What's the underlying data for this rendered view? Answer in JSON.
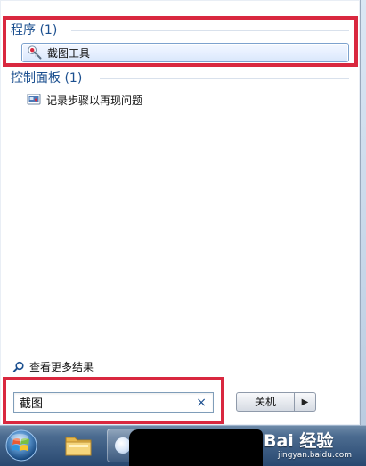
{
  "start_menu": {
    "sections": [
      {
        "title": "程序 (1)",
        "items": [
          {
            "label": "截图工具",
            "icon": "snipping-tool-icon",
            "selected": true
          }
        ]
      },
      {
        "title": "控制面板 (1)",
        "items": [
          {
            "label": "记录步骤以再现问题",
            "icon": "steps-recorder-icon",
            "selected": false
          }
        ]
      }
    ],
    "see_more_results": "查看更多结果",
    "search": {
      "value": "截图",
      "clear_icon": "clear-search-icon",
      "clear_glyph": "×"
    },
    "shutdown": {
      "label": "关机",
      "arrow_icon": "chevron-right-icon",
      "arrow_glyph": "▶"
    }
  },
  "taskbar": {
    "icons": [
      "windows-start-orb-icon",
      "folder-icon",
      "app-icon"
    ]
  },
  "watermark": {
    "main": "Bai 经验",
    "sub": "jingyan.baidu.com"
  },
  "colors": {
    "annotation_red": "#d9283f",
    "section_blue": "#1b4f8f",
    "taskbar_blue": "#27476f"
  }
}
